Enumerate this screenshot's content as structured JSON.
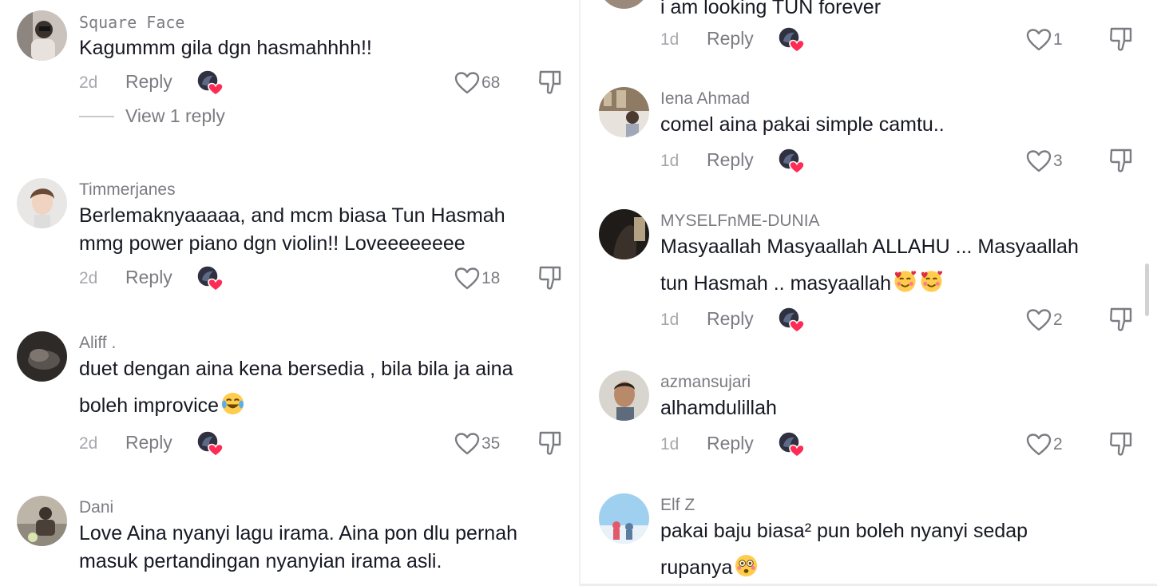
{
  "labels": {
    "reply": "Reply",
    "view_replies": "View 1 reply"
  },
  "left_comments": [
    {
      "username": "Square Face",
      "lines": [
        "Kagummm gila dgn hasmahhhh!!"
      ],
      "time": "2d",
      "likes": "68"
    },
    {
      "username": "Timmerjanes",
      "lines": [
        "Berlemaknyaaaaa, and mcm biasa Tun Hasmah",
        "mmg power piano dgn violin!! Loveeeeeeee"
      ],
      "time": "2d",
      "likes": "18"
    },
    {
      "username": "Aliff .",
      "lines": [
        "duet dengan aina kena bersedia , bila bila ja aina",
        "boleh improvice"
      ],
      "time": "2d",
      "likes": "35"
    },
    {
      "username": "Dani",
      "lines": [
        "Love Aina nyanyi lagu irama. Aina pon dlu pernah",
        "masuk pertandingan nyanyian irama asli."
      ]
    }
  ],
  "right_comments": [
    {
      "lines": [
        "i am looking TUN forever"
      ],
      "time": "1d",
      "likes": "1"
    },
    {
      "username": "Iena Ahmad",
      "lines": [
        "comel aina pakai simple camtu.."
      ],
      "time": "1d",
      "likes": "3"
    },
    {
      "username": "MYSELFnME-DUNIA",
      "lines": [
        "Masyaallah Masyaallah ALLAHU ... Masyaallah",
        "tun Hasmah .. masyaallah"
      ],
      "time": "1d",
      "likes": "2"
    },
    {
      "username": "azmansujari",
      "lines": [
        "alhamdulillah"
      ],
      "time": "1d",
      "likes": "2"
    },
    {
      "username": "Elf Z",
      "lines": [
        "pakai baju biasa² pun boleh nyanyi sedap",
        "rupanya"
      ]
    }
  ],
  "icons": {
    "like": "heart-outline-icon",
    "dislike": "thumb-down-icon",
    "creator_liked": "creator-liked-badge-icon",
    "laugh_emoji": "face-with-tears-of-joy-emoji",
    "love_emoji": "smiling-face-with-hearts-emoji",
    "flushed_emoji": "flushed-face-emoji"
  },
  "colors": {
    "text": "#161823",
    "secondary": "#7b7c82",
    "time": "#a7a8ad",
    "heart_badge": "#fe2c55"
  }
}
